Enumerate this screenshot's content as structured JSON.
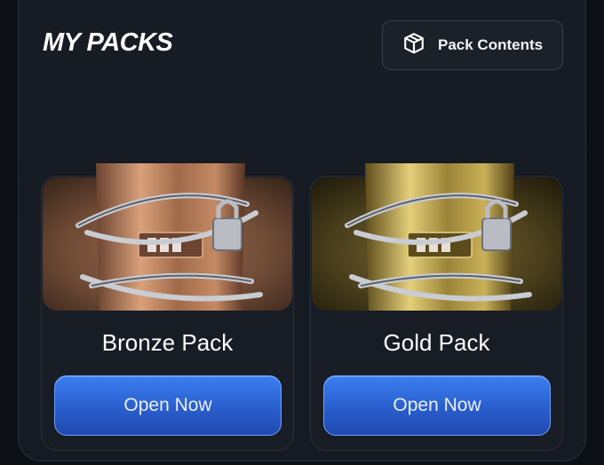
{
  "header": {
    "title": "MY PACKS",
    "contents_button_label": "Pack Contents",
    "contents_button_icon": "box-icon"
  },
  "packs": [
    {
      "name": "Bronze Pack",
      "button_label": "Open Now",
      "bg_color": "#6e4a35",
      "pack_color": "#a06a4a",
      "pack_highlight": "#d9a07a"
    },
    {
      "name": "Gold Pack",
      "button_label": "Open Now",
      "bg_color": "#4a3f1c",
      "pack_color": "#9b8438",
      "pack_highlight": "#e4cf7a"
    }
  ],
  "accent": "#2f6ad9"
}
